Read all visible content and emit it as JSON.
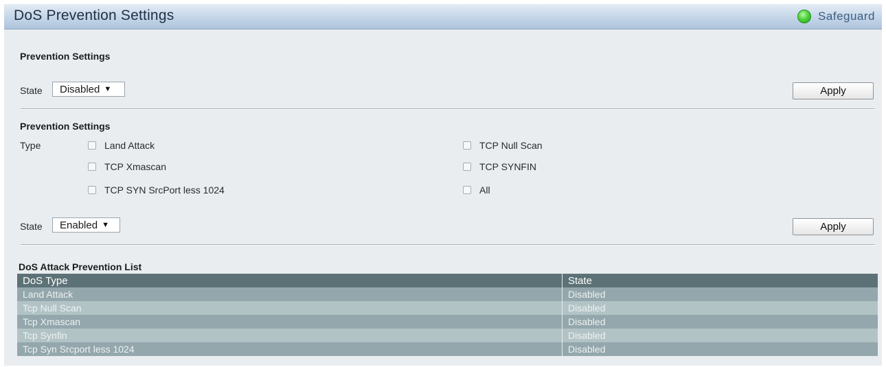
{
  "header": {
    "title": "DoS Prevention Settings",
    "safeguard_label": "Safeguard",
    "safeguard_color": "#3fcf32"
  },
  "section1": {
    "title": "Prevention Settings",
    "state_label": "State",
    "state_value": "Disabled",
    "apply_label": "Apply"
  },
  "section2": {
    "title": "Prevention Settings",
    "type_label": "Type",
    "options": [
      {
        "label": "Land Attack",
        "checked": false
      },
      {
        "label": "TCP Null Scan",
        "checked": false
      },
      {
        "label": "TCP Xmascan",
        "checked": false
      },
      {
        "label": "TCP SYNFIN",
        "checked": false
      },
      {
        "label": "TCP SYN SrcPort less 1024",
        "checked": false
      },
      {
        "label": "All",
        "checked": false
      }
    ],
    "state_label": "State",
    "state_value": "Enabled",
    "apply_label": "Apply"
  },
  "list": {
    "title": "DoS Attack Prevention List",
    "columns": [
      "DoS Type",
      "State"
    ],
    "rows": [
      [
        "Land Attack",
        "Disabled"
      ],
      [
        "Tcp Null Scan",
        "Disabled"
      ],
      [
        "Tcp Xmascan",
        "Disabled"
      ],
      [
        "Tcp Synfin",
        "Disabled"
      ],
      [
        "Tcp Syn Srcport less 1024",
        "Disabled"
      ]
    ]
  }
}
